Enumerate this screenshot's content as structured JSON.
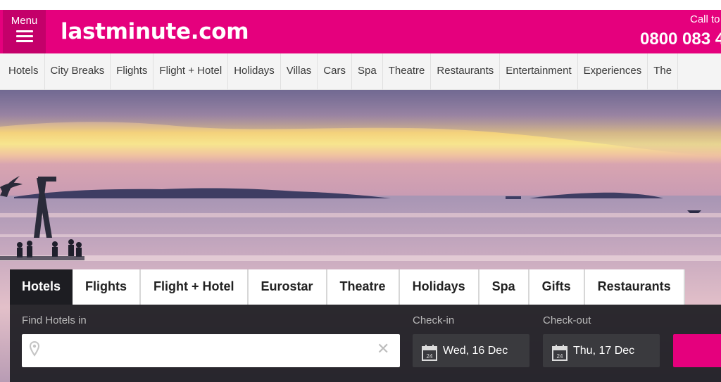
{
  "header": {
    "menu_label": "Menu",
    "logo": "lastminute.com",
    "call_label": "Call to",
    "call_number": "0800 083 4"
  },
  "nav": {
    "items": [
      "Hotels",
      "City Breaks",
      "Flights",
      "Flight + Hotel",
      "Holidays",
      "Villas",
      "Cars",
      "Spa",
      "Theatre",
      "Restaurants",
      "Entertainment",
      "Experiences",
      "The"
    ]
  },
  "search": {
    "tabs": [
      "Hotels",
      "Flights",
      "Flight + Hotel",
      "Eurostar",
      "Theatre",
      "Holidays",
      "Spa",
      "Gifts",
      "Restaurants"
    ],
    "active_tab": "Hotels",
    "destination_label": "Find Hotels in",
    "destination_value": "",
    "checkin_label": "Check-in",
    "checkin_value": "Wed, 16 Dec",
    "checkout_label": "Check-out",
    "checkout_value": "Thu, 17 Dec",
    "calendar_day": "24"
  },
  "colors": {
    "brand": "#e5007d",
    "brand_dark": "#c4006a",
    "panel": "#1d1d22"
  }
}
